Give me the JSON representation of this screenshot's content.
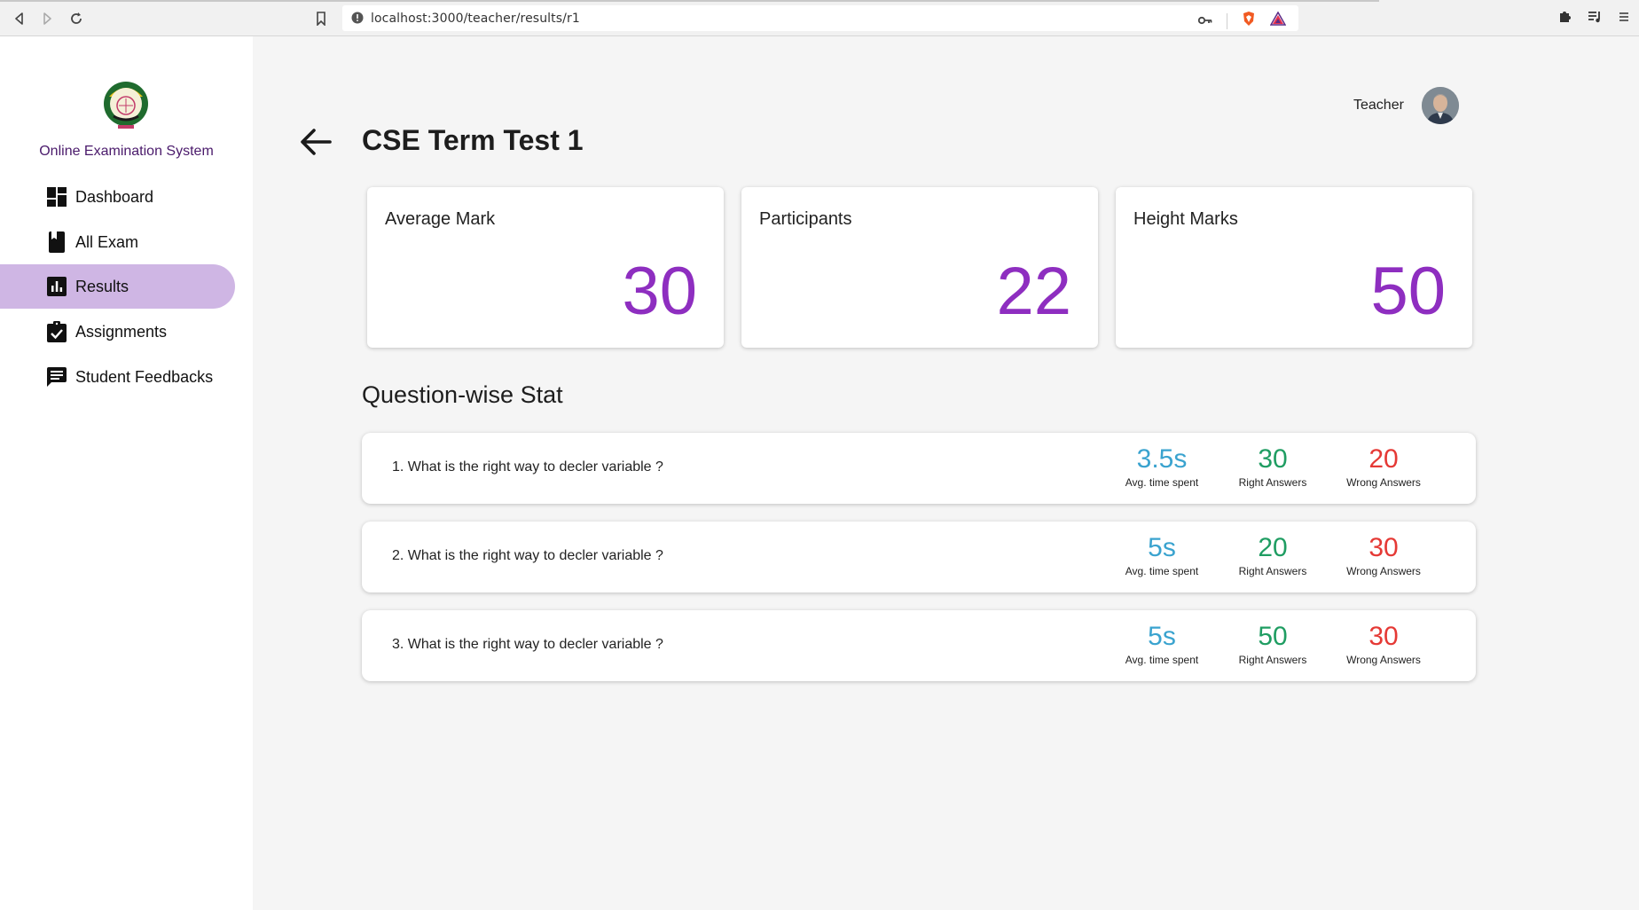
{
  "browser": {
    "url": "localhost:3000/teacher/results/r1"
  },
  "sidebar": {
    "app_name": "Online Examination System",
    "items": [
      {
        "label": "Dashboard",
        "icon": "dashboard-icon",
        "active": false
      },
      {
        "label": "All Exam",
        "icon": "book-icon",
        "active": false
      },
      {
        "label": "Results",
        "icon": "bar-chart-icon",
        "active": true
      },
      {
        "label": "Assignments",
        "icon": "assignment-check-icon",
        "active": false
      },
      {
        "label": "Student Feedbacks",
        "icon": "feedback-icon",
        "active": false
      }
    ]
  },
  "header": {
    "user_name": "Teacher",
    "title": "CSE Term Test 1"
  },
  "stats": [
    {
      "label": "Average Mark",
      "value": "30"
    },
    {
      "label": "Participants",
      "value": "22"
    },
    {
      "label": "Height Marks",
      "value": "50"
    }
  ],
  "questions_section": {
    "title": "Question-wise Stat",
    "time_caption": "Avg. time spent",
    "right_caption": "Right Answers",
    "wrong_caption": "Wrong Answers",
    "items": [
      {
        "text": "1. What is the right way to decler variable ?",
        "time": "3.5s",
        "right": "30",
        "wrong": "20"
      },
      {
        "text": "2. What is the right way to decler variable ?",
        "time": "5s",
        "right": "20",
        "wrong": "30"
      },
      {
        "text": "3. What is the right way to decler variable ?",
        "time": "5s",
        "right": "50",
        "wrong": "30"
      }
    ]
  },
  "colors": {
    "accent": "#8e2ec0",
    "active_nav": "#cfb6e4",
    "time": "#3aa3cf",
    "right": "#1f9d62",
    "wrong": "#e53935"
  }
}
